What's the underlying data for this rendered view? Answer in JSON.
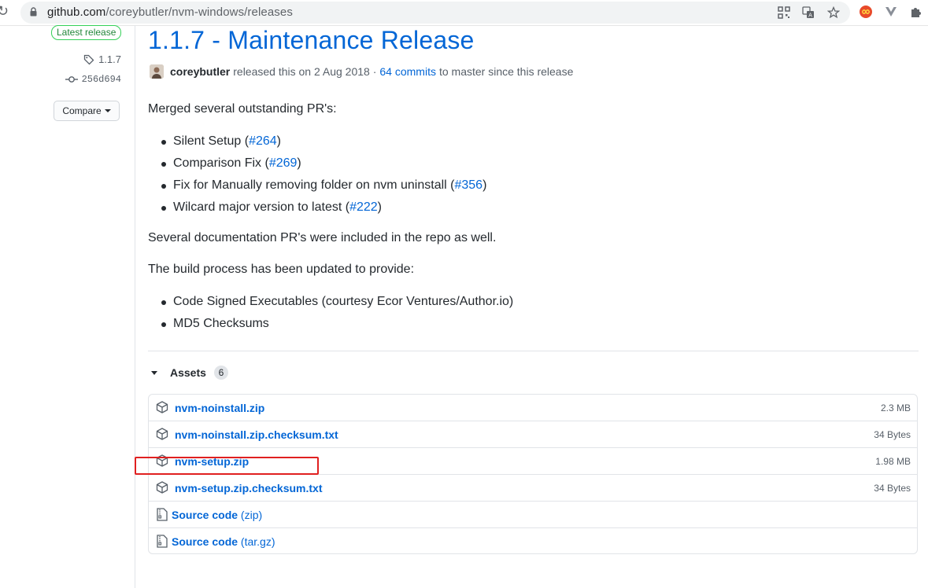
{
  "browser": {
    "url_host": "github.com",
    "url_path": "/coreybutler/nvm-windows/releases",
    "icons": [
      "reload-icon",
      "lock-icon",
      "qr-code-icon",
      "translate-icon",
      "bookmark-star-icon",
      "extension-red-icon",
      "extension-v-icon",
      "puzzle-icon"
    ]
  },
  "sidebar": {
    "latest_badge": "Latest release",
    "tag": "1.1.7",
    "commit": "256d694",
    "compare_label": "Compare"
  },
  "release": {
    "title": "1.1.7 - Maintenance Release",
    "author": "coreybutler",
    "released_text": "released this on 2 Aug 2018 ·",
    "commits_link": "64 commits",
    "commits_suffix": "to master since this release",
    "intro": "Merged several outstanding PR's:",
    "prs": [
      {
        "text": "Silent Setup (",
        "link": "#264",
        "tail": ")"
      },
      {
        "text": "Comparison Fix (",
        "link": "#269",
        "tail": ")"
      },
      {
        "text": "Fix for Manually removing folder on nvm uninstall (",
        "link": "#356",
        "tail": ")"
      },
      {
        "text": "Wilcard major version to latest (",
        "link": "#222",
        "tail": ")"
      }
    ],
    "doc_note": "Several documentation PR's were included in the repo as well.",
    "build_intro": "The build process has been updated to provide:",
    "build_items": [
      "Code Signed Executables (courtesy Ecor Ventures/Author.io)",
      "MD5 Checksums"
    ]
  },
  "assets": {
    "label": "Assets",
    "count": "6",
    "files": [
      {
        "name": "nvm-noinstall.zip",
        "size": "2.3 MB"
      },
      {
        "name": "nvm-noinstall.zip.checksum.txt",
        "size": "34 Bytes"
      },
      {
        "name": "nvm-setup.zip",
        "size": "1.98 MB"
      },
      {
        "name": "nvm-setup.zip.checksum.txt",
        "size": "34 Bytes"
      }
    ],
    "sources": [
      {
        "name": "Source code",
        "fmt": "(zip)"
      },
      {
        "name": "Source code",
        "fmt": "(tar.gz)"
      }
    ]
  },
  "colors": {
    "link": "#0366d6",
    "badge_green": "#22863a",
    "highlight_red": "#e02020"
  }
}
